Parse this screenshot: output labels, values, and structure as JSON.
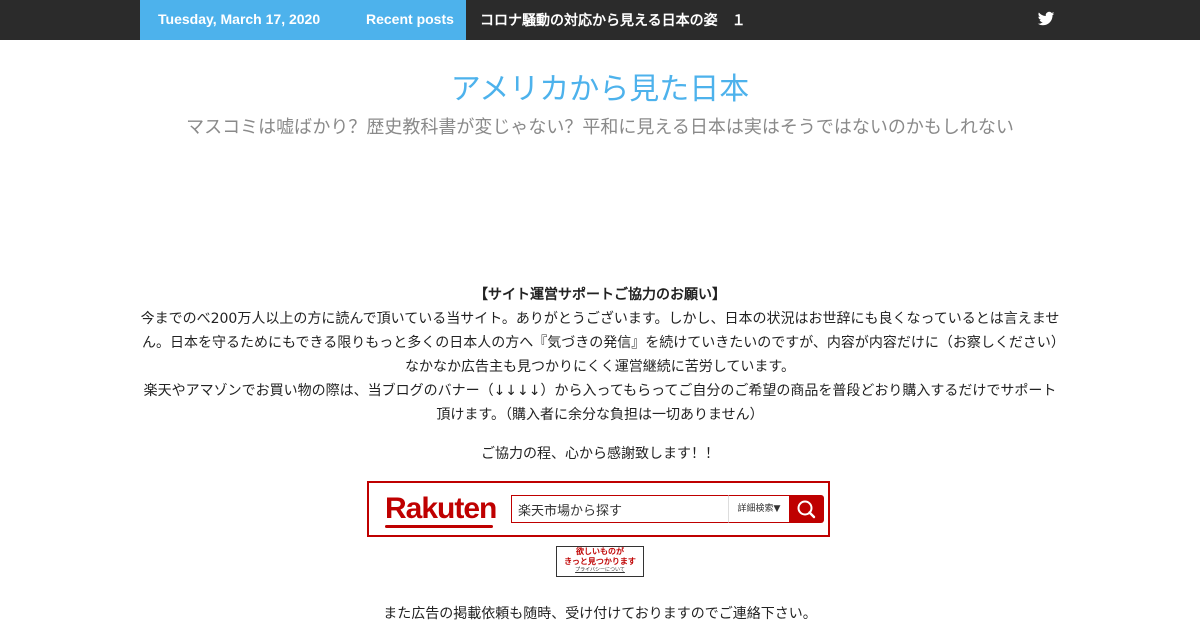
{
  "topbar": {
    "date": "Tuesday, March 17, 2020",
    "recent_label": "Recent posts",
    "ticker_text": "コロナ騒動の対応から見える日本の姿　１",
    "twitter_icon": "twitter-icon",
    "accent": "#4db2ec",
    "bg": "#2b2b2b"
  },
  "header": {
    "title": "アメリカから見た日本",
    "description": "マスコミは嘘ばかり？歴史教科書が変じゃない？平和に見える日本は実はそうではないのかもしれない"
  },
  "notice": {
    "heading": "【サイト運営サポートご協力のお願い】",
    "para1": "今までのべ200万人以上の方に読んで頂いている当サイト。ありがとうございます。しかし、日本の状況はお世辞にも良くなっているとは言えません。日本を守るためにもできる限りもっと多くの日本人の方へ『気づきの発信』を続けていきたいのですが、内容が内容だけに（お察しください）なかなか広告主も見つかりにくく運営継続に苦労しています。",
    "para2": "楽天やアマゾンでお買い物の際は、当ブログのバナー（↓↓↓↓）から入ってもらってご自分のご希望の商品を普段どおり購入するだけでサポート頂けます。（購入者に余分な負担は一切ありません）",
    "thanks": "ご協力の程、心から感謝致します！！"
  },
  "rakuten": {
    "logo": "Rakuten",
    "search_value": "楽天市場から探す",
    "detail_label": "詳細検索▼",
    "search_icon": "magnifier-icon",
    "brand_color": "#bf0000"
  },
  "banner": {
    "line1": "欲しいものが",
    "line2": "きっと見つかります",
    "privacy": "プライバシーについて"
  },
  "footer_note": "また広告の掲載依頼も随時、受け付けておりますのでご連絡下さい。"
}
